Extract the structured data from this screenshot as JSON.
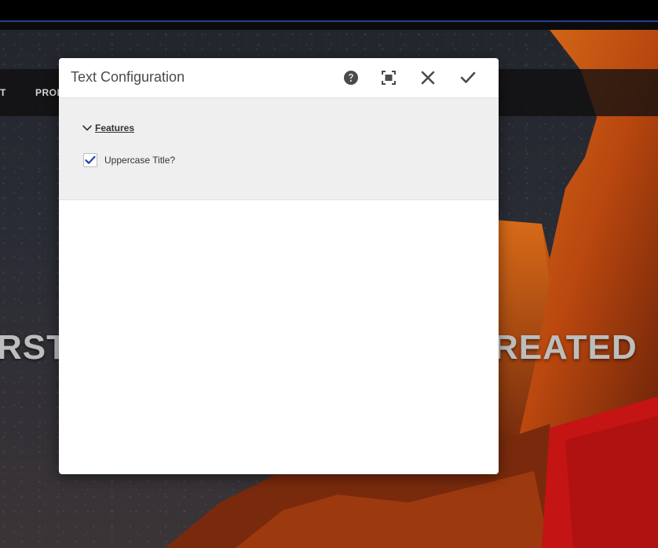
{
  "site": {
    "nav_items": [
      "T",
      "PROD"
    ],
    "hero_left": "RST",
    "hero_right": "REATED"
  },
  "dialog": {
    "title": "Text Configuration",
    "buttons": {
      "help": "help-icon",
      "fullscreen": "fullscreen-icon",
      "close": "close-icon",
      "done": "checkmark-icon"
    },
    "section": {
      "label": "Features",
      "expanded": true
    },
    "fields": [
      {
        "label": "Uppercase Title?",
        "checked": true
      }
    ]
  },
  "colors": {
    "accent": "#2d3fa8",
    "topbar_border": "#2a3f8f",
    "dialog_body": "#efefef",
    "icon": "#4b4b4b"
  }
}
